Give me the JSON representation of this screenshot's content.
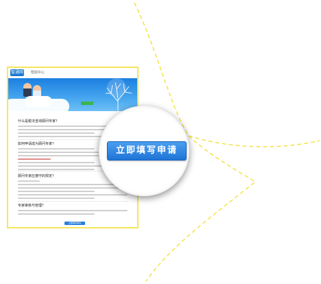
{
  "header": {
    "logo_text": "智通网",
    "logo_sub": "",
    "top_link": "帮助中心"
  },
  "banner": {
    "title": "",
    "desc": "",
    "button": ""
  },
  "sections": [
    {
      "title": "什么是税法咨询顾问专家？"
    },
    {
      "title": "如何申请成为顾问专家？"
    },
    {
      "title": "顾问专家应遵守的规定？"
    },
    {
      "title": "专家审核与管理？"
    }
  ],
  "bottom_button": "立即填写申请",
  "cta": {
    "label": "立即填写申请"
  },
  "colors": {
    "frame": "#f5e55a",
    "cta": "#2a7fd8",
    "arc": "#f3e24a"
  }
}
